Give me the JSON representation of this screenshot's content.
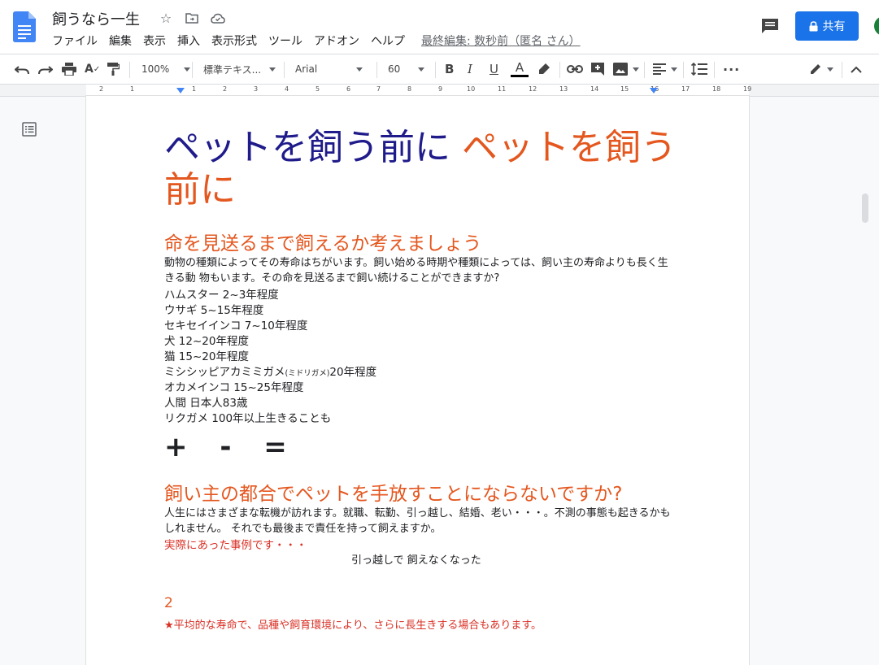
{
  "app": {
    "doc_title": "飼うなら一生",
    "menu": [
      "ファイル",
      "編集",
      "表示",
      "挿入",
      "表示形式",
      "ツール",
      "アドオン",
      "ヘルプ"
    ],
    "last_edit": "最終編集: 数秒前（匿名 さん）",
    "share_label": "共有",
    "accent": "#1a73e8"
  },
  "toolbar": {
    "zoom": "100%",
    "style": "標準テキス...",
    "font": "Arial",
    "size": "60"
  },
  "ruler": {
    "numbers": [
      "2",
      "1",
      "1",
      "2",
      "3",
      "4",
      "5",
      "6",
      "7",
      "8",
      "9",
      "10",
      "11",
      "12",
      "13",
      "14",
      "15",
      "16",
      "17",
      "18",
      "19"
    ]
  },
  "document": {
    "title_part1": "ペットを飼う前に",
    "title_part2_line1": "ペットを飼う",
    "title_part2_line2": "前に",
    "heading1": "命を見送るまで飼えるか考えましょう",
    "para1": "動物の種類によってその寿命はちがいます。飼い始める時期や種類によっては、飼い主の寿命よりも長く生きる動 物もいます。その命を見送るまで飼い続けることができますか?",
    "lifespans": [
      "ハムスター 2~3年程度",
      "ウサギ 5~15年程度",
      "セキセイインコ 7~10年程度",
      "犬 12~20年程度",
      "猫 15~20年程度"
    ],
    "turtle_main": "ミシシッピアカミミガメ",
    "turtle_small": "(ミドリガメ)",
    "turtle_years": "20年程度",
    "lifespans2": [
      "オカメインコ 15~25年程度",
      "人間 日本人83歳",
      "リクガメ 100年以上生きることも"
    ],
    "symbols": "+ - =",
    "heading2": "飼い主の都合でペットを手放すことにならないですか?",
    "para2": "人生にはさまざまな転機が訪れます。就職、転勤、引っ越し、結婚、老い・・・。不測の事態も起きるかもしれません。 それでも最後まで責任を持って飼えますか。",
    "cases_label": "実際にあった事例です・・・",
    "case1": "引っ越しで 飼えなくなった",
    "footnote_number": "2",
    "footnote": "★平均的な寿命で、品種や飼育環境により、さらに長生きする場合もあります。"
  }
}
